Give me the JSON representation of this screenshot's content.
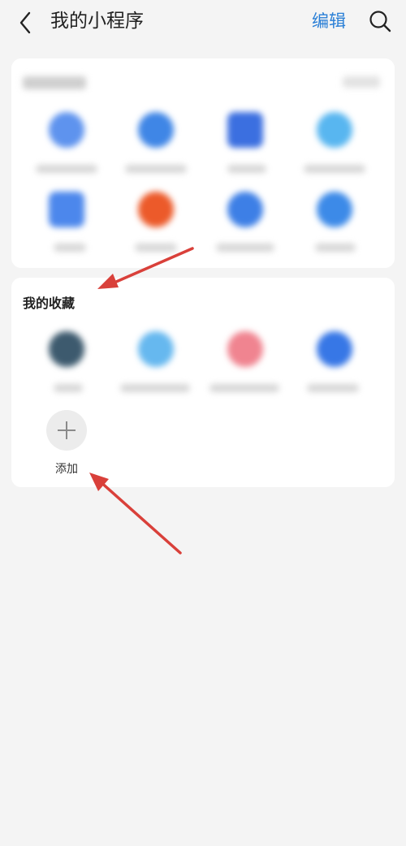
{
  "header": {
    "title": "我的小程序",
    "edit_label": "编辑",
    "back_icon": "chevron-left-icon",
    "search_icon": "search-icon"
  },
  "favorites": {
    "section_title": "我的收藏",
    "add_label": "添加",
    "add_icon": "plus-icon"
  },
  "colors": {
    "accent": "#2a7fd6",
    "background": "#f4f4f4",
    "card": "#ffffff",
    "annotation_arrow": "#d9403a"
  }
}
